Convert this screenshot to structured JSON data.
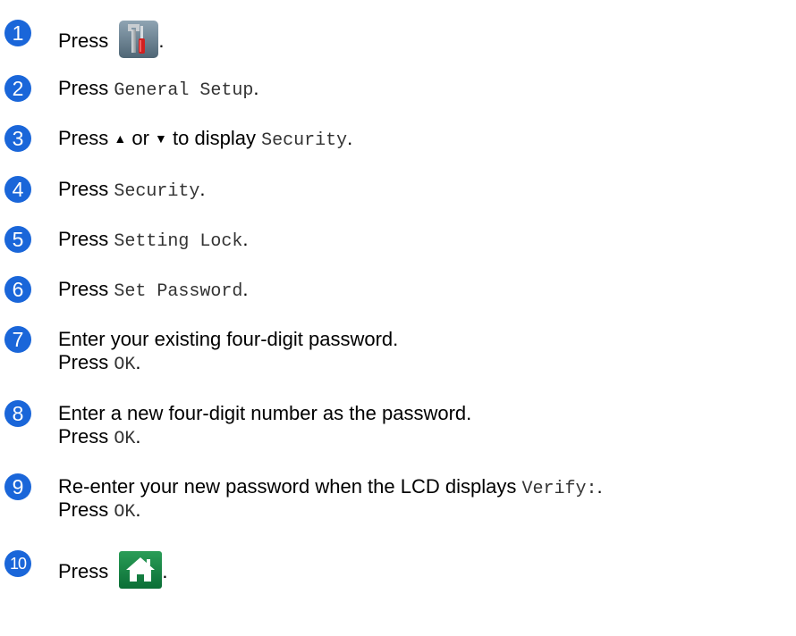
{
  "accent_color": "#1a66d9",
  "steps": [
    {
      "number": "1",
      "lead": "Press",
      "icon": "settings-tools-icon",
      "tail": "."
    },
    {
      "number": "2",
      "lead": "Press",
      "code": "General Setup",
      "tail": "."
    },
    {
      "number": "3",
      "lead": "Press",
      "up_symbol": "▲",
      "or_text": "or",
      "down_symbol": "▼",
      "to_text": "to display",
      "code": "Security",
      "tail": "."
    },
    {
      "number": "4",
      "lead": "Press",
      "code": "Security",
      "tail": "."
    },
    {
      "number": "5",
      "lead": "Press",
      "code": "Setting Lock",
      "tail": "."
    },
    {
      "number": "6",
      "lead": "Press",
      "code": "Set Password",
      "tail": "."
    },
    {
      "number": "7",
      "text": "Enter your existing four-digit password.",
      "lead2": "Press",
      "code2": "OK",
      "tail2": "."
    },
    {
      "number": "8",
      "text": "Enter a new four-digit number as the password.",
      "lead2": "Press",
      "code2": "OK",
      "tail2": "."
    },
    {
      "number": "9",
      "text": "Re-enter your new password when the LCD displays",
      "code": "Verify:",
      "tail": ".",
      "lead2": "Press",
      "code2": "OK",
      "tail2": "."
    },
    {
      "number": "10",
      "lead": "Press",
      "icon": "home-icon",
      "tail": "."
    }
  ]
}
